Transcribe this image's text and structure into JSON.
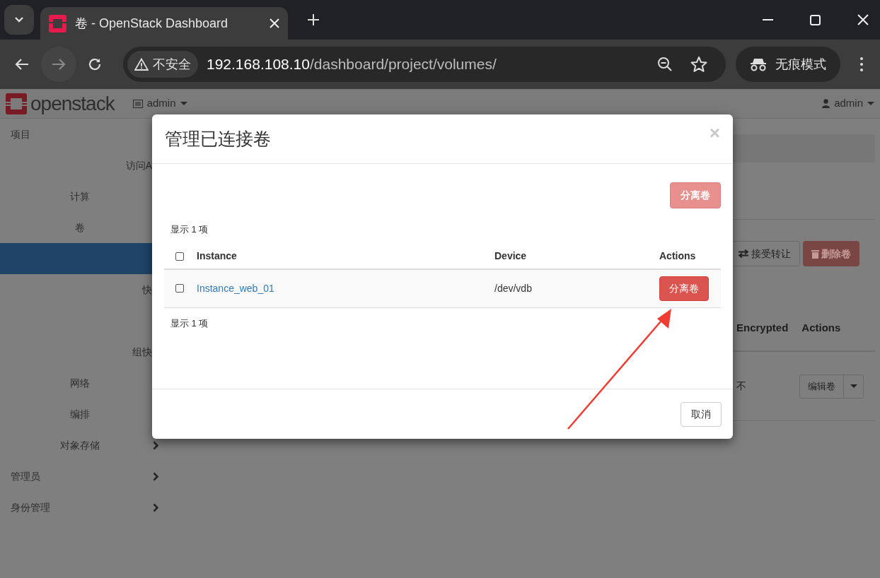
{
  "browser": {
    "tab_title": "卷 - OpenStack Dashboard",
    "security": "不安全",
    "url_host": "192.168.108.10",
    "url_path": "/dashboard/project/volumes/",
    "incognito": "无痕模式"
  },
  "header": {
    "logo": "openstack",
    "project": "admin",
    "user": "admin"
  },
  "sidebar": {
    "items": [
      {
        "kind": "section",
        "label": "项目",
        "chevron": false,
        "selected": false
      },
      {
        "kind": "item",
        "label": "访问A",
        "chevron": false,
        "selected": false
      },
      {
        "kind": "group",
        "label": "计算",
        "chevron": false,
        "selected": false
      },
      {
        "kind": "group",
        "label": "卷",
        "chevron": false,
        "selected": false
      },
      {
        "kind": "item",
        "chevron": false,
        "selected": true
      },
      {
        "kind": "item",
        "label": "快",
        "chevron": false,
        "selected": false
      },
      {
        "kind": "item",
        "chevron": false,
        "selected": false
      },
      {
        "kind": "item",
        "label": "组快",
        "chevron": false,
        "selected": false
      },
      {
        "kind": "group",
        "label": "网络",
        "chevron": false,
        "selected": false
      },
      {
        "kind": "group",
        "label": "编排",
        "chevron": false,
        "selected": false
      },
      {
        "kind": "group",
        "label": "对象存储",
        "chevron": true,
        "selected": false
      },
      {
        "kind": "section",
        "label": "管理员",
        "chevron": true,
        "selected": false
      },
      {
        "kind": "section",
        "label": "身份管理",
        "chevron": true,
        "selected": false
      }
    ]
  },
  "page": {
    "buttons": [
      {
        "kind": "transfer",
        "label": "接受转让"
      },
      {
        "kind": "delete",
        "label": "删除卷"
      }
    ],
    "columns": [
      "Encrypted",
      "Actions"
    ],
    "row": {
      "encrypted": "不",
      "action": "编辑卷"
    }
  },
  "modal": {
    "title": "管理已连接卷",
    "close": "×",
    "bulk_button": {
      "label": "分离卷",
      "disabled": true
    },
    "count_top": "显示 1 项",
    "columns": [
      "Instance",
      "Device",
      "Actions"
    ],
    "header_checked": false,
    "rows": [
      {
        "instance": "Instance_web_01",
        "device": "/dev/vdb",
        "action": "分离卷",
        "checked": false
      }
    ],
    "count_bottom": "显示 1 项",
    "cancel": "取消"
  }
}
